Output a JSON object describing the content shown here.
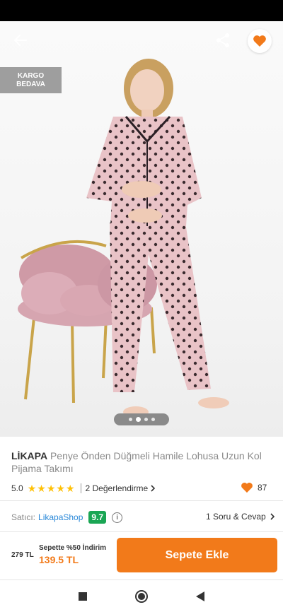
{
  "header": {
    "back_icon": "arrow-left-icon",
    "share_icon": "share-icon",
    "favorite_icon": "heart-icon"
  },
  "badge": {
    "line1": "KARGO",
    "line2": "BEDAVA"
  },
  "gallery": {
    "image_count": 4,
    "active_index": 1
  },
  "product": {
    "brand": "LİKAPA",
    "name": "Penye Önden Düğmeli Hamile Lohusa Uzun Kol Pijama Takımı",
    "rating": "5.0",
    "stars": 5,
    "reviews_label": "2 Değerlendirme",
    "likes": "87"
  },
  "seller": {
    "label": "Satıcı:",
    "name": "LikapaShop",
    "score": "9.7",
    "qa_label": "1 Soru & Cevap"
  },
  "pricing": {
    "old_price": "279 TL",
    "promo": "Sepette %50 İndirim",
    "new_price": "139.5 TL",
    "add_to_cart": "Sepete Ekle"
  },
  "colors": {
    "accent": "#f27a1a",
    "star": "#ffc107",
    "seller_link": "#2a88d8",
    "score_bg": "#1aa654"
  }
}
